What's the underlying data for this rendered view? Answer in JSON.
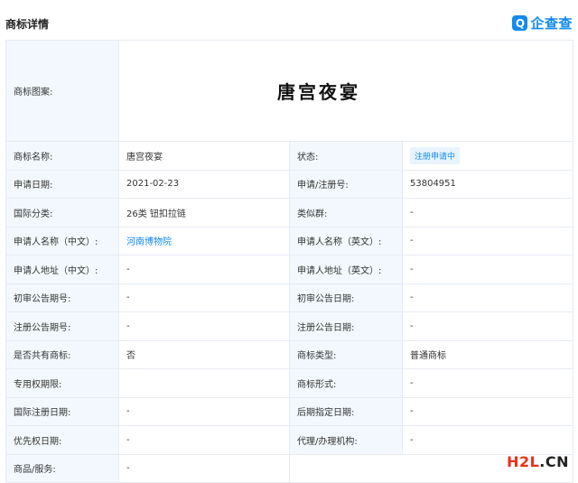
{
  "header": {
    "title": "商标详情",
    "brand_icon": "Q",
    "brand_name": "企查查",
    "brand_color": "#128bed"
  },
  "trademark": {
    "image_label": "商标图案:",
    "image_text": "唐宫夜宴",
    "rows": [
      [
        "商标名称:",
        "唐宫夜宴",
        "状态:",
        "注册申请中"
      ],
      [
        "申请日期:",
        "2021-02-23",
        "申请/注册号:",
        "53804951"
      ],
      [
        "国际分类:",
        "26类 钮扣拉链",
        "类似群:",
        "-"
      ],
      [
        "申请人名称（中文）:",
        "河南博物院",
        "申请人名称（英文）:",
        "-"
      ],
      [
        "申请人地址（中文）:",
        "-",
        "申请人地址（英文）:",
        "-"
      ],
      [
        "初审公告期号:",
        "-",
        "初审公告日期:",
        "-"
      ],
      [
        "注册公告期号:",
        "-",
        "注册公告日期:",
        "-"
      ],
      [
        "是否共有商标:",
        "否",
        "商标类型:",
        "普通商标"
      ],
      [
        "专用权期限:",
        "",
        "商标形式:",
        "-"
      ],
      [
        "国际注册日期:",
        "-",
        "后期指定日期:",
        "-"
      ],
      [
        "优先权日期:",
        "-",
        "代理/办理机构:",
        "-"
      ]
    ],
    "last_row": [
      "商品/服务:",
      "-"
    ]
  },
  "watermark": {
    "part1": "H2L",
    "part2": ".CN",
    "color1": "#e8311a",
    "color2": "#222222"
  }
}
